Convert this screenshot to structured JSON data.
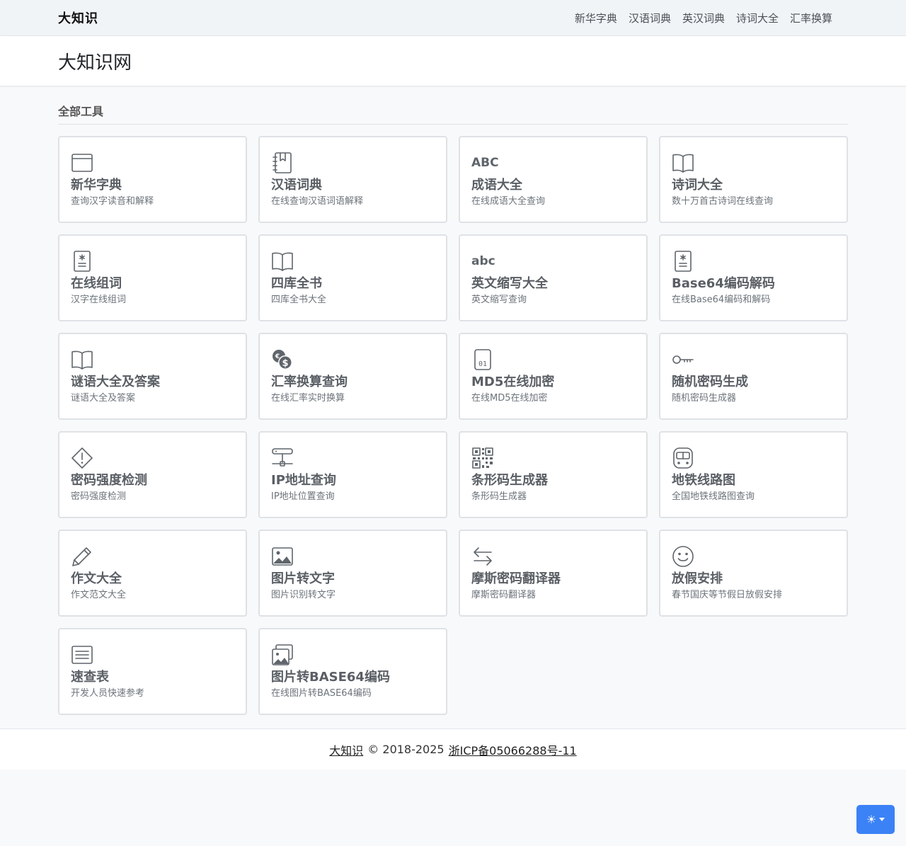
{
  "navbar": {
    "brand": "大知识",
    "links": [
      "新华字典",
      "汉语词典",
      "英汉词典",
      "诗词大全",
      "汇率换算"
    ]
  },
  "header": {
    "title": "大知识网"
  },
  "section": {
    "title": "全部工具"
  },
  "tools": [
    {
      "icon": "window-icon",
      "title": "新华字典",
      "desc": "查询汉字读音和解释"
    },
    {
      "icon": "journal-bookmark-icon",
      "title": "汉语词典",
      "desc": "在线查询汉语词语解释"
    },
    {
      "icon": "abc-uppercase-icon",
      "icon_text": "ABC",
      "title": "成语大全",
      "desc": "在线成语大全查询"
    },
    {
      "icon": "open-book-icon",
      "title": "诗词大全",
      "desc": "数十万首古诗词在线查询"
    },
    {
      "icon": "file-medical-icon",
      "title": "在线组词",
      "desc": "汉字在线组词"
    },
    {
      "icon": "open-book-icon",
      "title": "四库全书",
      "desc": "四库全书大全"
    },
    {
      "icon": "abc-lowercase-icon",
      "icon_text": "abc",
      "title": "英文缩写大全",
      "desc": "英文缩写查询"
    },
    {
      "icon": "file-medical-icon",
      "title": "Base64编码解码",
      "desc": "在线Base64编码和解码"
    },
    {
      "icon": "open-book-icon",
      "title": "谜语大全及答案",
      "desc": "谜语大全及答案"
    },
    {
      "icon": "currency-exchange-icon",
      "title": "汇率换算查询",
      "desc": "在线汇率实时换算"
    },
    {
      "icon": "file-binary-icon",
      "title": "MD5在线加密",
      "desc": "在线MD5在线加密"
    },
    {
      "icon": "key-icon",
      "title": "随机密码生成",
      "desc": "随机密码生成器"
    },
    {
      "icon": "warning-diamond-icon",
      "title": "密码强度检测",
      "desc": "密码强度检测"
    },
    {
      "icon": "network-icon",
      "title": "IP地址查询",
      "desc": "IP地址位置查询"
    },
    {
      "icon": "qr-code-icon",
      "title": "条形码生成器",
      "desc": "条形码生成器"
    },
    {
      "icon": "train-icon",
      "title": "地铁线路图",
      "desc": "全国地铁线路图查询"
    },
    {
      "icon": "pencil-icon",
      "title": "作文大全",
      "desc": "作文范文大全"
    },
    {
      "icon": "image-icon",
      "title": "图片转文字",
      "desc": "图片识别转文字"
    },
    {
      "icon": "arrows-exchange-icon",
      "title": "摩斯密码翻译器",
      "desc": "摩斯密码翻译器"
    },
    {
      "icon": "smile-icon",
      "title": "放假安排",
      "desc": "春节国庆等节假日放假安排"
    },
    {
      "icon": "text-lines-icon",
      "title": "速查表",
      "desc": "开发人员快速参考"
    },
    {
      "icon": "images-icon",
      "title": "图片转BASE64编码",
      "desc": "在线图片转BASE64编码"
    }
  ],
  "footer": {
    "brand": "大知识",
    "copyright": "© 2018-2025",
    "icp": "浙ICP备05066288号-11"
  },
  "theme_toggle": {
    "icon": "sun-icon"
  },
  "colors": {
    "accent": "#3b82f6",
    "icon": "#5f656b",
    "card_border": "#dee2e6"
  }
}
